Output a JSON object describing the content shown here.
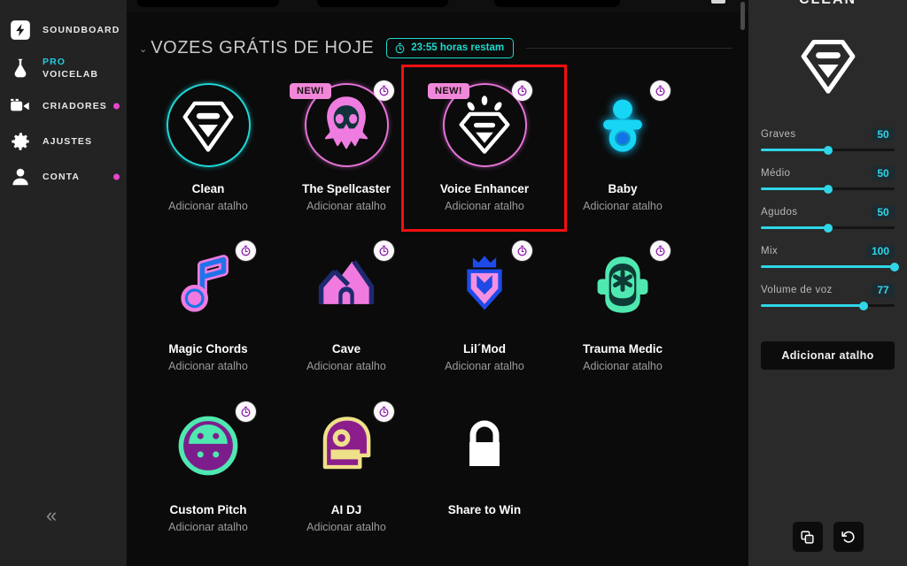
{
  "sidebar": {
    "items": [
      {
        "label": "SOUNDBOARD",
        "icon": "bolt-icon",
        "dot": false
      },
      {
        "label_line1": "PRO",
        "label_line2": "VOICELAB",
        "icon": "flask-icon",
        "dot": false
      },
      {
        "label": "CRIADORES",
        "icon": "video-camera-icon",
        "dot": true
      },
      {
        "label": "AJUSTES",
        "icon": "gear-icon",
        "dot": false
      },
      {
        "label": "CONTA",
        "icon": "user-icon",
        "dot": true
      }
    ],
    "collapse_glyph": "«",
    "pro_color": "#22c9e0",
    "dot_color": "#e845d0"
  },
  "main": {
    "section_title": "VOZES GRÁTIS DE HOJE",
    "chevron_glyph": "⌄",
    "timer_badge": {
      "text": "23:55 horas restam",
      "icon": "stopwatch-icon",
      "color": "#1fd9d0"
    },
    "add_shortcut_label": "Adicionar atalho",
    "new_badge_label": "NEW!",
    "selection_outline_color": "#f40f0f",
    "cards": [
      {
        "title": "Clean",
        "sub": "Adicionar atalho",
        "icon": "diamond-icon",
        "ring": "teal",
        "new": false,
        "timer": false,
        "selected": false
      },
      {
        "title": "The Spellcaster",
        "sub": "Adicionar atalho",
        "icon": "skull-mask-icon",
        "ring": "pink",
        "new": true,
        "timer": true,
        "selected": true
      },
      {
        "title": "Voice Enhancer",
        "sub": "Adicionar atalho",
        "icon": "diamond-spark-icon",
        "ring": "pink",
        "new": true,
        "timer": true,
        "selected": false
      },
      {
        "title": "Baby",
        "sub": "Adicionar atalho",
        "icon": "pacifier-icon",
        "ring": "none",
        "new": false,
        "timer": true,
        "selected": false
      },
      {
        "title": "Magic Chords",
        "sub": "Adicionar atalho",
        "icon": "music-note-icon",
        "ring": "none",
        "new": false,
        "timer": true,
        "selected": false
      },
      {
        "title": "Cave",
        "sub": "Adicionar atalho",
        "icon": "cave-icon",
        "ring": "none",
        "new": false,
        "timer": true,
        "selected": false
      },
      {
        "title": "Lil´Mod",
        "sub": "Adicionar atalho",
        "icon": "crown-shield-icon",
        "ring": "none",
        "new": false,
        "timer": true,
        "selected": false
      },
      {
        "title": "Trauma Medic",
        "sub": "Adicionar atalho",
        "icon": "medic-mask-icon",
        "ring": "none",
        "new": false,
        "timer": true,
        "selected": false
      },
      {
        "title": "Custom Pitch",
        "sub": "Adicionar atalho",
        "icon": "face-circle-icon",
        "ring": "none",
        "new": false,
        "timer": true,
        "selected": false
      },
      {
        "title": "AI DJ",
        "sub": "Adicionar atalho",
        "icon": "dj-helmet-icon",
        "ring": "none",
        "new": false,
        "timer": true,
        "selected": false
      },
      {
        "title": "Share to Win",
        "sub": "",
        "icon": "lock-icon",
        "ring": "none",
        "new": false,
        "timer": false,
        "selected": false
      }
    ]
  },
  "right_panel": {
    "title": "CLEAN",
    "preview_icon": "diamond-icon",
    "sliders": [
      {
        "label": "Graves",
        "value": 50,
        "percent": 50
      },
      {
        "label": "Médio",
        "value": 50,
        "percent": 50
      },
      {
        "label": "Agudos",
        "value": 50,
        "percent": 50
      },
      {
        "label": "Mix",
        "value": 100,
        "percent": 100
      },
      {
        "label": "Volume de voz",
        "value": 77,
        "percent": 77
      }
    ],
    "accent_color": "#2fd6e8",
    "add_shortcut_label": "Adicionar atalho",
    "footer_buttons": [
      {
        "name": "copy-icon",
        "label": "Copiar"
      },
      {
        "name": "reset-icon",
        "label": "Redefinir"
      }
    ]
  }
}
